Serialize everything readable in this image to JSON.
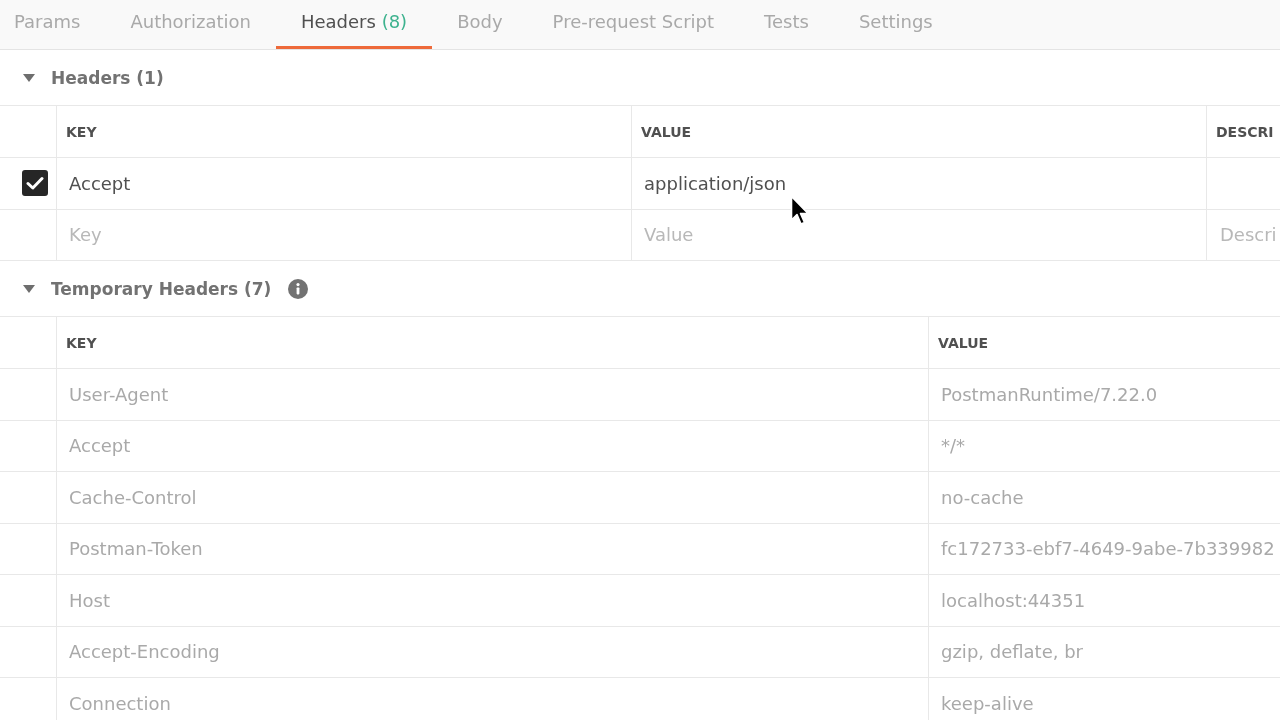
{
  "tabs": [
    {
      "label": "Params",
      "selected": false
    },
    {
      "label": "Authorization",
      "selected": false
    },
    {
      "label": "Headers",
      "count": "(8)",
      "selected": true
    },
    {
      "label": "Body",
      "selected": false
    },
    {
      "label": "Pre-request Script",
      "selected": false
    },
    {
      "label": "Tests",
      "selected": false
    },
    {
      "label": "Settings",
      "selected": false
    }
  ],
  "sections": [
    {
      "kind": "editable",
      "title": "Headers (1)",
      "expanded": true,
      "columns": [
        "KEY",
        "VALUE",
        "DESCRI"
      ],
      "rows": [
        {
          "kind": "entry",
          "checked": true,
          "key": "Accept",
          "value": "application/json"
        },
        {
          "kind": "new",
          "key": {
            "placeholder": "Key"
          },
          "value": {
            "placeholder": "Value"
          },
          "description": {
            "placeholder": "Descri"
          }
        }
      ]
    },
    {
      "kind": "readonly",
      "title": "Temporary Headers (7)",
      "expanded": true,
      "info": true,
      "columns": [
        "KEY",
        "VALUE"
      ],
      "rows": [
        {
          "key": "User-Agent",
          "value": "PostmanRuntime/7.22.0"
        },
        {
          "key": "Accept",
          "value": "*/*"
        },
        {
          "key": "Cache-Control",
          "value": "no-cache"
        },
        {
          "key": "Postman-Token",
          "value": "fc172733-ebf7-4649-9abe-7b339982"
        },
        {
          "key": "Host",
          "value": "localhost:44351"
        },
        {
          "key": "Accept-Encoding",
          "value": "gzip, deflate, br"
        },
        {
          "key": "Connection",
          "value": "keep-alive"
        }
      ]
    }
  ]
}
